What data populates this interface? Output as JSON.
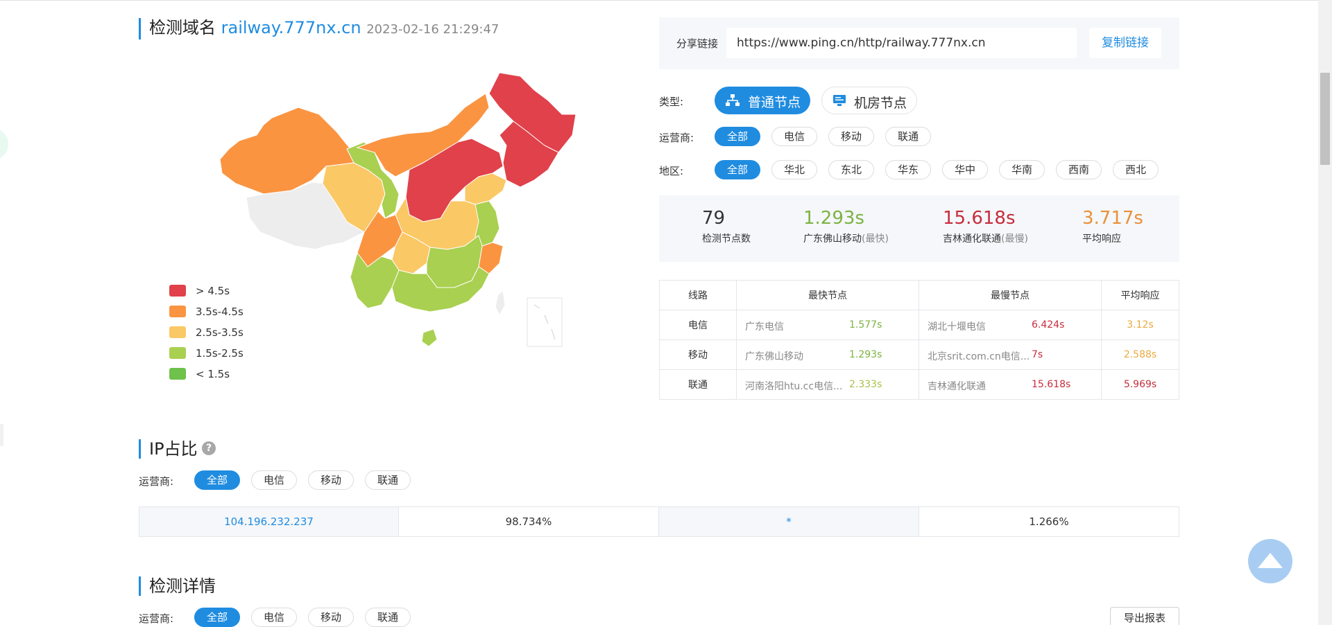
{
  "header": {
    "title_prefix": "检测域名",
    "domain": "railway.777nx.cn",
    "timestamp": "2023-02-16 21:29:47"
  },
  "share": {
    "label": "分享链接",
    "url": "https://www.ping.cn/http/railway.777nx.cn",
    "copy_label": "复制链接"
  },
  "filters": {
    "type_label": "类型:",
    "type_options": [
      "普通节点",
      "机房节点"
    ],
    "isp_label": "运营商:",
    "isp_options": [
      "全部",
      "电信",
      "移动",
      "联通"
    ],
    "region_label": "地区:",
    "region_options": [
      "全部",
      "华北",
      "东北",
      "华东",
      "华中",
      "华南",
      "西南",
      "西北"
    ]
  },
  "stats": [
    {
      "value": "79",
      "label": "检测节点数",
      "tag": "",
      "color": "#333333"
    },
    {
      "value": "1.293s",
      "label": "广东佛山移动",
      "tag": "(最快)",
      "color": "#7cb342"
    },
    {
      "value": "15.618s",
      "label": "吉林通化联通",
      "tag": "(最慢)",
      "color": "#c62d3c"
    },
    {
      "value": "3.717s",
      "label": "平均响应",
      "tag": "",
      "color": "#e8913a"
    }
  ],
  "table": {
    "headers": [
      "线路",
      "最快节点",
      "最慢节点",
      "平均响应"
    ],
    "rows": [
      {
        "line": "电信",
        "fast_name": "广东电信",
        "fast_time": "1.577s",
        "slow_name": "湖北十堰电信",
        "slow_time": "6.424s",
        "avg": "3.12s",
        "avg_color": "#e9a93c"
      },
      {
        "line": "移动",
        "fast_name": "广东佛山移动",
        "fast_time": "1.293s",
        "slow_name": "北京srit.com.cn电信...",
        "slow_time": "7s",
        "avg": "2.588s",
        "avg_color": "#e9a93c"
      },
      {
        "line": "联通",
        "fast_name": "河南洛阳htu.cc电信...",
        "fast_time": "2.333s",
        "slow_name": "吉林通化联通",
        "slow_time": "15.618s",
        "avg": "5.969s",
        "avg_color": "#c62d3c"
      }
    ]
  },
  "legend": [
    {
      "label": "> 4.5s",
      "color": "#e0414b"
    },
    {
      "label": "3.5s-4.5s",
      "color": "#fa9441"
    },
    {
      "label": "2.5s-3.5s",
      "color": "#fbc866"
    },
    {
      "label": "1.5s-2.5s",
      "color": "#a9d050"
    },
    {
      "label": "< 1.5s",
      "color": "#6ec14b"
    }
  ],
  "ip_section": {
    "title": "IP占比",
    "isp_label": "运营商:",
    "isp_options": [
      "全部",
      "电信",
      "移动",
      "联通"
    ],
    "ip1": "104.196.232.237",
    "pct1": "98.734%",
    "ip2": "*",
    "pct2": "1.266%"
  },
  "detail_section": {
    "title": "检测详情",
    "isp_label": "运营商:",
    "isp_options": [
      "全部",
      "电信",
      "移动",
      "联通"
    ],
    "export_label": "导出报表"
  }
}
